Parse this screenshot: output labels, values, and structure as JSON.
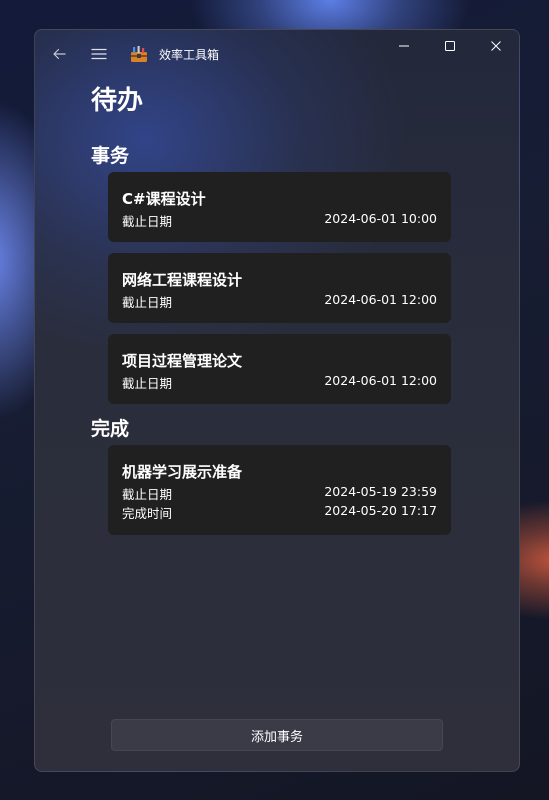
{
  "app": {
    "title": "效率工具箱",
    "icon": "toolbox-icon"
  },
  "page": {
    "title": "待办"
  },
  "sections": {
    "pending": {
      "title": "事务",
      "items": [
        {
          "title": "C#课程设计",
          "deadline_label": "截止日期",
          "deadline": "2024-06-01 10:00"
        },
        {
          "title": "网络工程课程设计",
          "deadline_label": "截止日期",
          "deadline": "2024-06-01 12:00"
        },
        {
          "title": "项目过程管理论文",
          "deadline_label": "截止日期",
          "deadline": "2024-06-01 12:00"
        }
      ]
    },
    "done": {
      "title": "完成",
      "items": [
        {
          "title": "机器学习展示准备",
          "deadline_label": "截止日期",
          "deadline": "2024-05-19 23:59",
          "completed_label": "完成时间",
          "completed": "2024-05-20 17:17"
        }
      ]
    }
  },
  "actions": {
    "add_label": "添加事务"
  },
  "colors": {
    "card_bg": "#202020",
    "button_bg": "#3b3b47",
    "text": "#ffffff"
  }
}
